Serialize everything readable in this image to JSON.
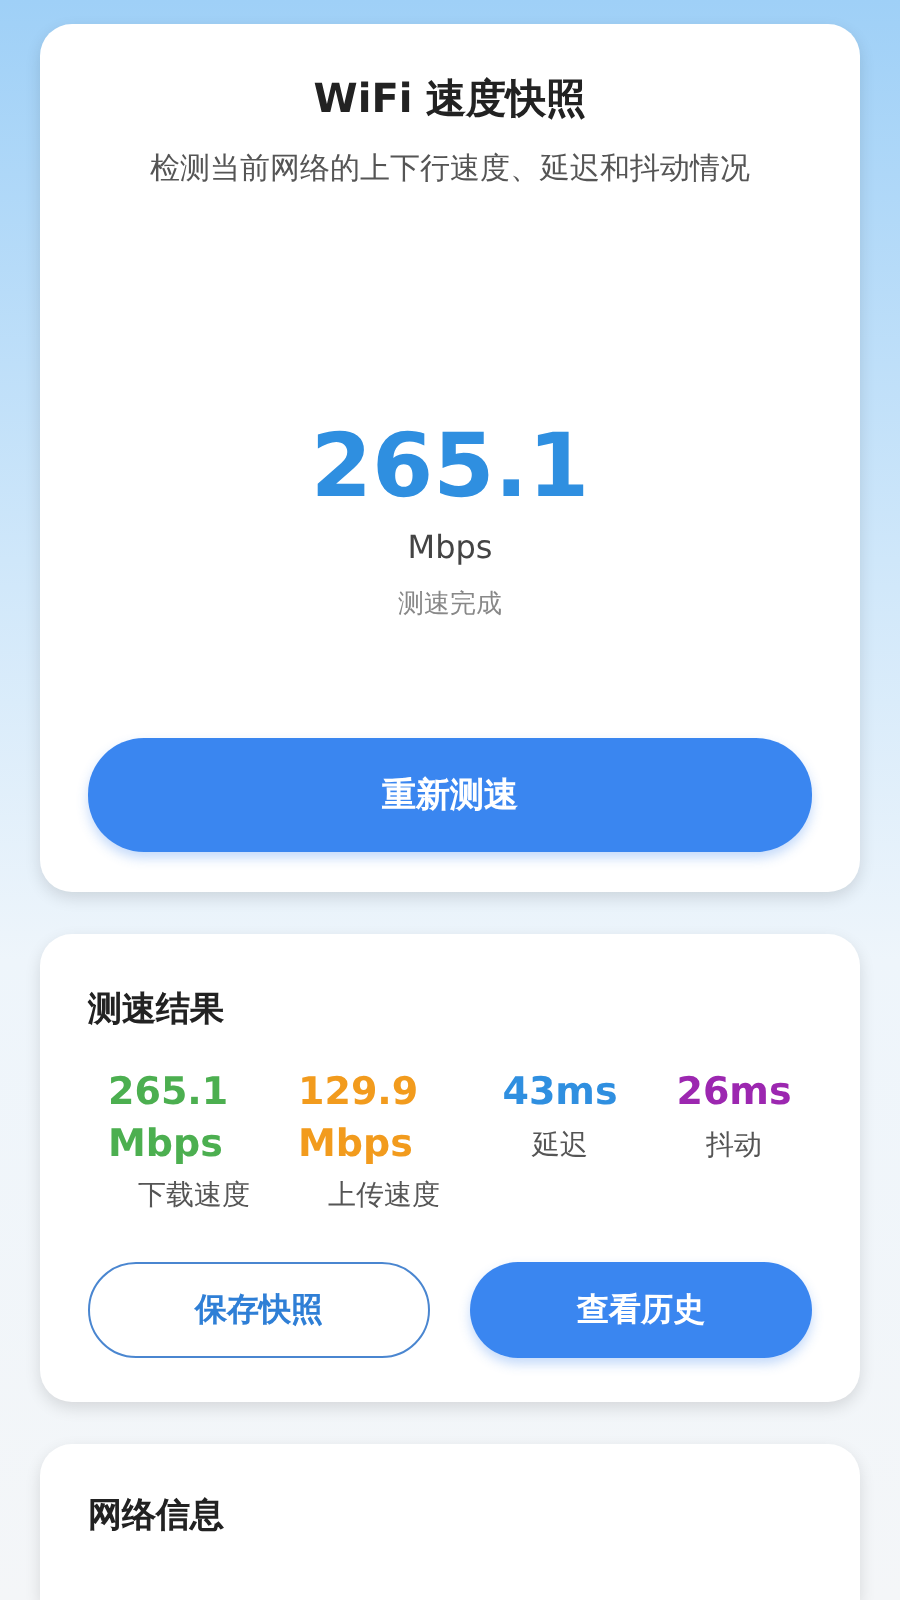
{
  "header": {
    "title": "WiFi 速度快照",
    "subtitle": "检测当前网络的上下行速度、延迟和抖动情况",
    "speed": "265.1",
    "unit": "Mbps",
    "status": "测速完成",
    "button": "重新测速"
  },
  "results": {
    "title": "测速结果",
    "metrics": [
      {
        "value": "265.1 Mbps",
        "label": "下载速度",
        "color": "#4caf50"
      },
      {
        "value": "129.9 Mbps",
        "label": "上传速度",
        "color": "#f29b1d"
      },
      {
        "value": "43ms",
        "label": "延迟",
        "color": "#2f8fe0"
      },
      {
        "value": "26ms",
        "label": "抖动",
        "color": "#9c27b0"
      }
    ],
    "buttons": [
      {
        "label": "保存快照",
        "kind": "outline"
      },
      {
        "label": "查看历史",
        "kind": "primary"
      }
    ]
  },
  "network": {
    "title": "网络信息"
  }
}
